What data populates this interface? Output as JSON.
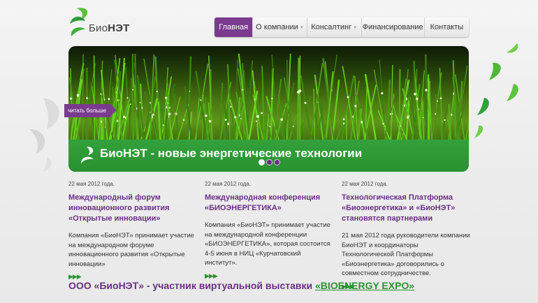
{
  "logo": {
    "text_a": "Био",
    "text_b": "НЭТ"
  },
  "nav": {
    "items": [
      {
        "label": "Главная",
        "active": true,
        "dropdown": false
      },
      {
        "label": "О компании",
        "active": false,
        "dropdown": true
      },
      {
        "label": "Консалтинг",
        "active": false,
        "dropdown": true
      },
      {
        "label": "Финансирование",
        "active": false,
        "dropdown": false
      },
      {
        "label": "Контакты",
        "active": false,
        "dropdown": false
      }
    ]
  },
  "banner": {
    "readmore_label": "читать больше",
    "title": "БиоНЭТ - новые энергетические технологии",
    "slides": 3,
    "active_slide": 1
  },
  "news": [
    {
      "date": "22 мая 2012 года.",
      "title": "Международный форум инновационного развития «Открытые инновации»",
      "text": "Компания «БиоНЭТ» принимает участие на международном форуме инновационного развития «Открытые инновации»",
      "more": "▶▶▶"
    },
    {
      "date": "22 мая 2012 года.",
      "title": "Международная конференция «БИОЭНЕРГЕТИКА»",
      "text": "Компания «БиоНЭТ» принимает участие на международной конференции «БИОЭНЕРГЕТИКА», которая состоится 4-5 июня в НИЦ «Курчатовский институт».",
      "more": "▶▶▶"
    },
    {
      "date": "22 мая 2012 года.",
      "title": "Технологическая Платформа «Биоэнергетика» и «БиоНЭТ» становятся партнерами",
      "text": "21 мая 2012 года руководители компании БиоНЭТ и координаторы Технологической Платформы «Биоэнергетика» договорились о совместном сотрудничестве.",
      "more": "▶▶▶"
    }
  ],
  "expo": {
    "prefix": "ООО «БиоНЭТ» - участник виртуальной выставки ",
    "link": "«BIOENERGY EXPO»"
  },
  "colors": {
    "purple": "#7a3b8e",
    "green": "#2a9131",
    "title_purple": "#6a2f84"
  }
}
